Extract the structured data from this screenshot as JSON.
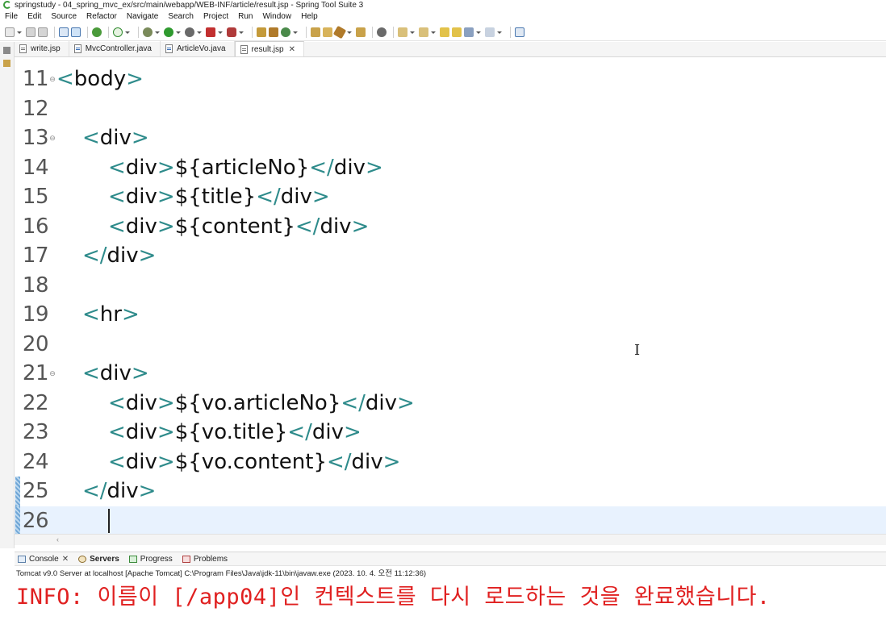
{
  "window": {
    "title": "springstudy - 04_spring_mvc_ex/src/main/webapp/WEB-INF/article/result.jsp - Spring Tool Suite 3"
  },
  "menu": {
    "items": [
      "File",
      "Edit",
      "Source",
      "Refactor",
      "Navigate",
      "Search",
      "Project",
      "Run",
      "Window",
      "Help"
    ]
  },
  "tabs": [
    {
      "label": "write.jsp",
      "kind": "jsp",
      "active": false
    },
    {
      "label": "MvcController.java",
      "kind": "java",
      "active": false
    },
    {
      "label": "ArticleVo.java",
      "kind": "java",
      "active": false
    },
    {
      "label": "result.jsp",
      "kind": "jsp",
      "active": true
    }
  ],
  "editor": {
    "lines": [
      {
        "num": "11",
        "fold": true,
        "indent": 0,
        "text": "<body>",
        "tokens": [
          [
            "tag",
            "<"
          ],
          [
            "el",
            "body"
          ],
          [
            "tag",
            ">"
          ]
        ]
      },
      {
        "num": "12",
        "fold": false,
        "indent": 0,
        "text": "",
        "tokens": []
      },
      {
        "num": "13",
        "fold": true,
        "indent": 1,
        "text": "<div>",
        "tokens": [
          [
            "tag",
            "<"
          ],
          [
            "el",
            "div"
          ],
          [
            "tag",
            ">"
          ]
        ]
      },
      {
        "num": "14",
        "fold": false,
        "indent": 2,
        "text": "<div>${articleNo}</div>",
        "tokens": [
          [
            "tag",
            "<"
          ],
          [
            "el",
            "div"
          ],
          [
            "tag",
            ">"
          ],
          [
            "el",
            "${articleNo}"
          ],
          [
            "tag",
            "</"
          ],
          [
            "el",
            "div"
          ],
          [
            "tag",
            ">"
          ]
        ]
      },
      {
        "num": "15",
        "fold": false,
        "indent": 2,
        "text": "<div>${title}</div>",
        "tokens": [
          [
            "tag",
            "<"
          ],
          [
            "el",
            "div"
          ],
          [
            "tag",
            ">"
          ],
          [
            "el",
            "${title}"
          ],
          [
            "tag",
            "</"
          ],
          [
            "el",
            "div"
          ],
          [
            "tag",
            ">"
          ]
        ]
      },
      {
        "num": "16",
        "fold": false,
        "indent": 2,
        "text": "<div>${content}</div>",
        "tokens": [
          [
            "tag",
            "<"
          ],
          [
            "el",
            "div"
          ],
          [
            "tag",
            ">"
          ],
          [
            "el",
            "${content}"
          ],
          [
            "tag",
            "</"
          ],
          [
            "el",
            "div"
          ],
          [
            "tag",
            ">"
          ]
        ]
      },
      {
        "num": "17",
        "fold": false,
        "indent": 1,
        "text": "</div>",
        "tokens": [
          [
            "tag",
            "</"
          ],
          [
            "el",
            "div"
          ],
          [
            "tag",
            ">"
          ]
        ]
      },
      {
        "num": "18",
        "fold": false,
        "indent": 0,
        "text": "",
        "tokens": []
      },
      {
        "num": "19",
        "fold": false,
        "indent": 1,
        "text": "<hr>",
        "tokens": [
          [
            "tag",
            "<"
          ],
          [
            "el",
            "hr"
          ],
          [
            "tag",
            ">"
          ]
        ]
      },
      {
        "num": "20",
        "fold": false,
        "indent": 0,
        "text": "",
        "tokens": []
      },
      {
        "num": "21",
        "fold": true,
        "indent": 1,
        "text": "<div>",
        "tokens": [
          [
            "tag",
            "<"
          ],
          [
            "el",
            "div"
          ],
          [
            "tag",
            ">"
          ]
        ]
      },
      {
        "num": "22",
        "fold": false,
        "indent": 2,
        "text": "<div>${vo.articleNo}</div>",
        "tokens": [
          [
            "tag",
            "<"
          ],
          [
            "el",
            "div"
          ],
          [
            "tag",
            ">"
          ],
          [
            "el",
            "${vo.articleNo}"
          ],
          [
            "tag",
            "</"
          ],
          [
            "el",
            "div"
          ],
          [
            "tag",
            ">"
          ]
        ]
      },
      {
        "num": "23",
        "fold": false,
        "indent": 2,
        "text": "<div>${vo.title}</div>",
        "tokens": [
          [
            "tag",
            "<"
          ],
          [
            "el",
            "div"
          ],
          [
            "tag",
            ">"
          ],
          [
            "el",
            "${vo.title}"
          ],
          [
            "tag",
            "</"
          ],
          [
            "el",
            "div"
          ],
          [
            "tag",
            ">"
          ]
        ]
      },
      {
        "num": "24",
        "fold": false,
        "indent": 2,
        "text": "<div>${vo.content}</div>",
        "tokens": [
          [
            "tag",
            "<"
          ],
          [
            "el",
            "div"
          ],
          [
            "tag",
            ">"
          ],
          [
            "el",
            "${vo.content}"
          ],
          [
            "tag",
            "</"
          ],
          [
            "el",
            "div"
          ],
          [
            "tag",
            ">"
          ]
        ]
      },
      {
        "num": "25",
        "fold": false,
        "indent": 1,
        "text": "</div>",
        "tokens": [
          [
            "tag",
            "</"
          ],
          [
            "el",
            "div"
          ],
          [
            "tag",
            ">"
          ]
        ],
        "changed": true
      },
      {
        "num": "26",
        "fold": false,
        "indent": 1,
        "text": "",
        "tokens": [],
        "changed": true,
        "current": true
      }
    ]
  },
  "console": {
    "tabs": [
      {
        "label": "Console",
        "icon": "console-icon",
        "closable": true,
        "bold": false
      },
      {
        "label": "Servers",
        "icon": "servers-icon",
        "closable": false,
        "bold": true
      },
      {
        "label": "Progress",
        "icon": "progress-icon",
        "closable": false,
        "bold": false
      },
      {
        "label": "Problems",
        "icon": "problems-icon",
        "closable": false,
        "bold": false
      }
    ],
    "info": "Tomcat v9.0 Server at localhost [Apache Tomcat] C:\\Program Files\\Java\\jdk-11\\bin\\javaw.exe  (2023. 10. 4. 오전 11:12:36)",
    "output": "INFO: 이름이 [/app04]인 컨텍스트를 다시 로드하는 것을 완료했습니다."
  },
  "colors": {
    "tag": "#2e8b8b",
    "current_line": "#e8f2fe",
    "console_error": "#e02020"
  }
}
